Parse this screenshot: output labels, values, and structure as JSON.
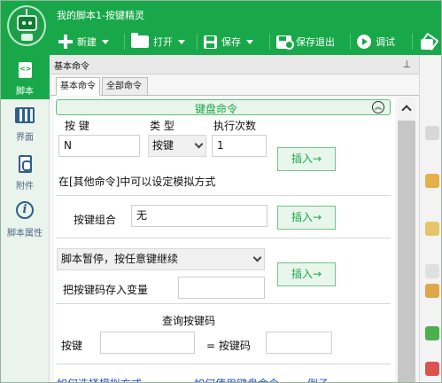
{
  "window": {
    "title": "我的脚本1-按键精灵"
  },
  "toolbar": {
    "new_label": "新建",
    "open_label": "打开",
    "save_label": "保存",
    "save_exit_label": "保存退出",
    "debug_label": "调试"
  },
  "sidebar": {
    "items": [
      {
        "label": "脚本",
        "icon": "script-icon",
        "active": true
      },
      {
        "label": "界面",
        "icon": "layout-icon",
        "active": false
      },
      {
        "label": "附件",
        "icon": "attachment-icon",
        "active": false
      },
      {
        "label": "脚本属性",
        "icon": "info-icon",
        "active": false
      }
    ]
  },
  "panel": {
    "header": "基本命令",
    "tabs": [
      {
        "label": "基本命令",
        "active": true
      },
      {
        "label": "全部命令",
        "active": false
      }
    ]
  },
  "keyboard": {
    "section_title": "键盘命令",
    "key_label": "按 键",
    "type_label": "类 型",
    "count_label": "执行次数",
    "key_value": "N",
    "type_value": "按键",
    "count_value": "1",
    "insert_label": "插入→",
    "hint": "在[其他命令]中可以设定模拟方式",
    "combo_label": "按键组合",
    "combo_value": "无",
    "combo_insert_label": "插入→",
    "pause_option": "脚本暂停，按任意键继续",
    "save_var_label": "把按键码存入变量",
    "pause_insert_label": "插入→",
    "query_title": "查询按键码",
    "query_key_label": "按键",
    "query_code_label": "= 按键码",
    "links": [
      "如何选择模拟方式",
      "如何使用键盘命令",
      "例子"
    ]
  },
  "colors": {
    "accent": "#18a84a",
    "link": "#1c55c6"
  }
}
